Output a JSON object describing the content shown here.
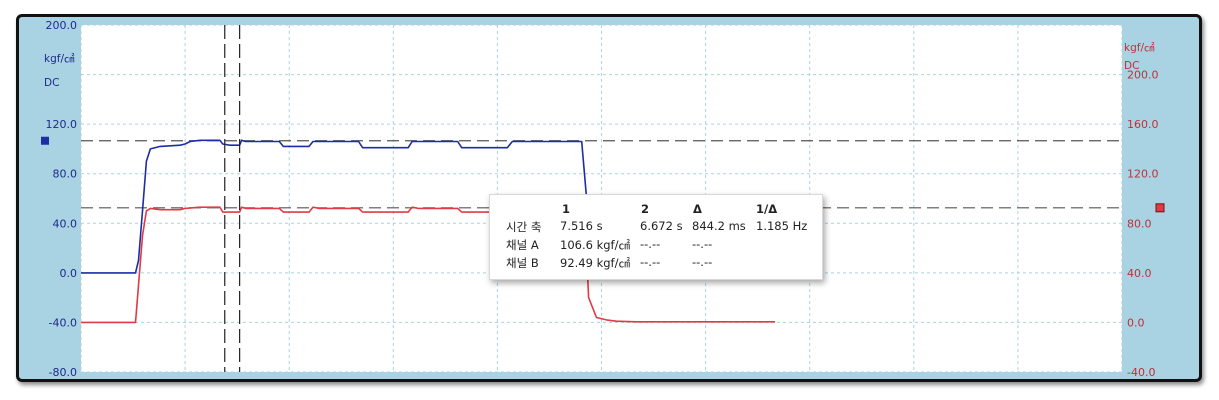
{
  "chart_data": {
    "type": "line",
    "title": "",
    "grid": true,
    "colors": {
      "channel_a": "#1d2da6",
      "channel_b": "#e03a44",
      "left_axis": "#1e2a8c",
      "right_axis": "#c0303a",
      "panel_bg": "#ffffff",
      "grid": "#a9d3e2",
      "border_bg": "#a9d3e2"
    },
    "left_axis": {
      "unit": "kgf/㎠",
      "coupling": "DC",
      "ticks": [
        "200.0",
        "120.0",
        "80.0",
        "40.0",
        "0.0",
        "-40.0",
        "-80.0"
      ],
      "ylim": [
        -80,
        200
      ]
    },
    "right_axis": {
      "unit": "kgf/㎠",
      "coupling": "DC",
      "ticks": [
        "200.0",
        "160.0",
        "120.0",
        "80.0",
        "40.0",
        "0.0",
        "-40.0"
      ],
      "ylim": [
        -40,
        240
      ]
    },
    "xlim": [
      0,
      10.5
    ],
    "cursors": {
      "t1": 7.516,
      "t2": 6.672
    },
    "level_markers": {
      "a": 106.6,
      "b": 92.49
    },
    "series": [
      {
        "name": "채널 A",
        "axis": "left",
        "x": [
          0,
          0.55,
          0.58,
          0.62,
          0.66,
          0.7,
          0.8,
          1.0,
          1.05,
          1.1,
          1.2,
          1.4,
          1.43,
          1.5,
          1.6,
          1.62,
          1.66,
          1.8,
          1.9,
          2.0,
          2.04,
          2.1,
          2.2,
          2.25,
          2.3,
          2.34,
          2.4,
          2.5,
          2.6,
          2.7,
          2.8,
          2.84,
          2.9,
          3.0,
          3.1,
          3.2,
          3.3,
          3.34,
          3.4,
          3.5,
          3.6,
          3.7,
          3.8,
          3.84,
          3.9,
          4.0,
          4.1,
          4.2,
          4.3,
          4.35,
          4.4,
          4.5,
          4.6,
          4.7,
          4.8,
          4.9,
          5.0,
          5.05,
          5.1,
          5.2,
          5.3,
          5.4,
          5.6,
          5.8,
          6.0,
          6.5,
          7.0
        ],
        "y": [
          0,
          0,
          10,
          50,
          90,
          100,
          102,
          103,
          104,
          106,
          107,
          107,
          104,
          103,
          103,
          107,
          106,
          106,
          106,
          106,
          102,
          102,
          102,
          102,
          102,
          106,
          106,
          106,
          106,
          106,
          106,
          101,
          101,
          101,
          101,
          101,
          101,
          106,
          106,
          106,
          106,
          106,
          106,
          101,
          101,
          101,
          101,
          101,
          101,
          106,
          106,
          106,
          106,
          106,
          106,
          106,
          106,
          106,
          60,
          20,
          5,
          3,
          2,
          1,
          1,
          0.5,
          0.5
        ]
      },
      {
        "name": "채널 B",
        "axis": "right",
        "x": [
          0,
          0.55,
          0.58,
          0.62,
          0.66,
          0.7,
          0.8,
          1.0,
          1.05,
          1.2,
          1.3,
          1.4,
          1.43,
          1.5,
          1.6,
          1.62,
          1.66,
          1.8,
          1.9,
          2.0,
          2.04,
          2.1,
          2.2,
          2.25,
          2.3,
          2.34,
          2.4,
          2.5,
          2.6,
          2.7,
          2.8,
          2.84,
          2.9,
          3.0,
          3.1,
          3.2,
          3.3,
          3.34,
          3.4,
          3.5,
          3.6,
          3.7,
          3.8,
          3.84,
          3.9,
          4.0,
          4.1,
          4.2,
          4.3,
          4.35,
          4.4,
          4.5,
          4.6,
          4.7,
          4.8,
          4.9,
          5.0,
          5.05,
          5.08,
          5.12,
          5.2,
          5.3,
          5.4,
          5.6,
          5.8,
          6.0,
          6.5,
          7.0
        ],
        "y": [
          0,
          0,
          30,
          70,
          90,
          92,
          91,
          91,
          92,
          93,
          93,
          93,
          89,
          89,
          89,
          93,
          92,
          92,
          92,
          92,
          89,
          89,
          89,
          89,
          89,
          93,
          92,
          92,
          92,
          92,
          92,
          89,
          89,
          89,
          89,
          89,
          89,
          93,
          92,
          92,
          92,
          92,
          92,
          89,
          89,
          89,
          89,
          89,
          89,
          93,
          92,
          92,
          92,
          92,
          92,
          92,
          92,
          93,
          92,
          20,
          4,
          2,
          1,
          0.5,
          0.5,
          0.5,
          0.5,
          0.5
        ]
      }
    ]
  },
  "measurement_table": {
    "columns": [
      "1",
      "2",
      "Δ",
      "1/Δ"
    ],
    "rows": [
      {
        "label": "시간 축",
        "values": [
          "7.516 s",
          "6.672 s",
          "844.2 ms",
          "1.185 Hz"
        ]
      },
      {
        "label": "채널 A",
        "values": [
          "106.6 kgf/㎠",
          "--.--",
          "--.--",
          ""
        ]
      },
      {
        "label": "채널 B",
        "values": [
          "92.49 kgf/㎠",
          "--.--",
          "--.--",
          ""
        ]
      }
    ]
  }
}
